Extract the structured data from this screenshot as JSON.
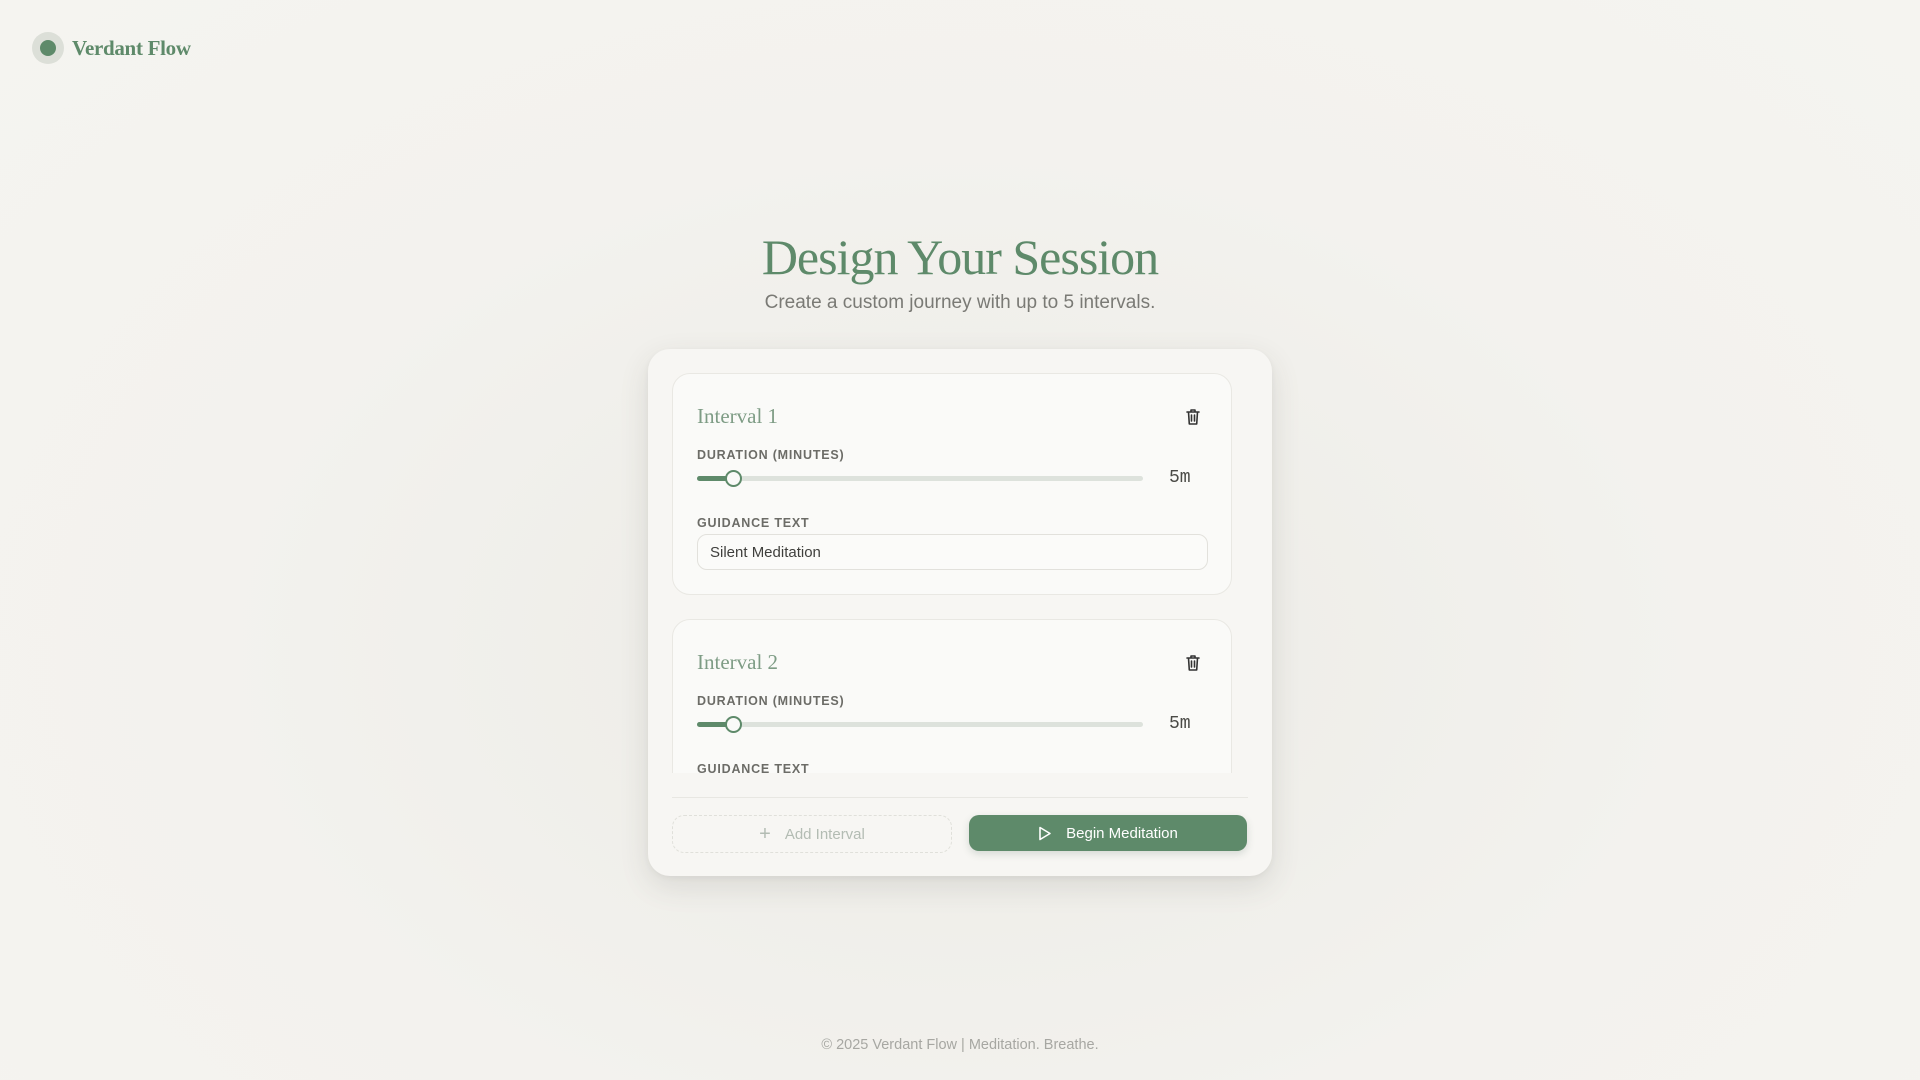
{
  "brand": {
    "name": "Verdant Flow"
  },
  "hero": {
    "title": "Design Your Session",
    "subtitle": "Create a custom journey with up to 5 intervals."
  },
  "intervals": [
    {
      "title": "Interval 1",
      "duration_label": "DURATION (MINUTES)",
      "duration_value": "5m",
      "duration_level": 0.08,
      "guidance_label": "GUIDANCE TEXT",
      "guidance_text": "Silent Meditation"
    },
    {
      "title": "Interval 2",
      "duration_label": "DURATION (MINUTES)",
      "duration_value": "5m",
      "duration_level": 0.08,
      "guidance_label": "GUIDANCE TEXT",
      "guidance_text": ""
    }
  ],
  "actions": {
    "add_label": "Add Interval",
    "begin_label": "Begin Meditation"
  },
  "footer": {
    "text": "© 2025 Verdant Flow | Meditation. Breathe."
  },
  "colors": {
    "accent": "#5e8a6a",
    "background": "#f3f2ee"
  },
  "icons": {
    "brand": "leaf-dot-icon",
    "delete": "trash-icon",
    "add": "plus-icon",
    "begin": "play-icon"
  }
}
